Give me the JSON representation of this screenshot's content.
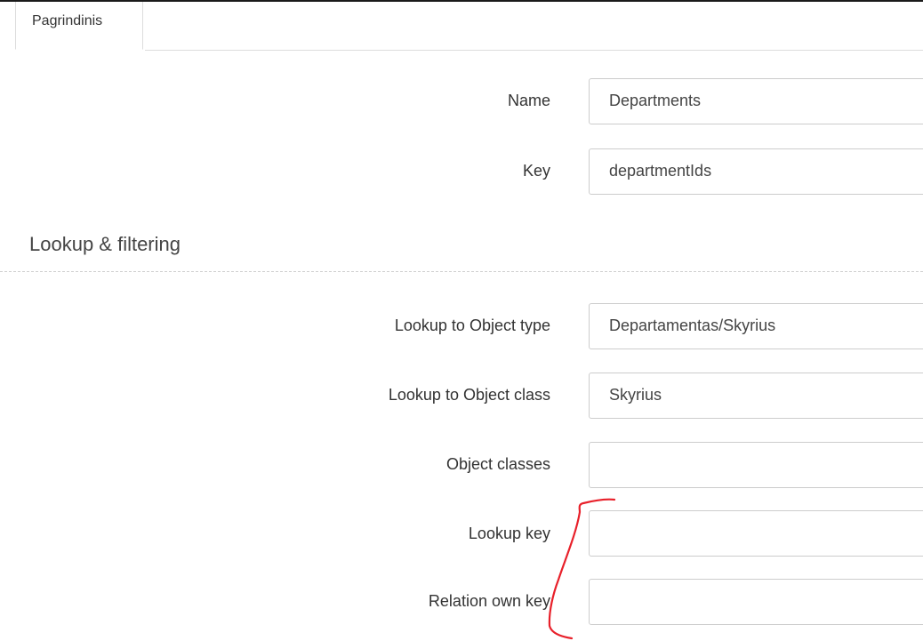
{
  "tabs": {
    "active_label": "Pagrindinis"
  },
  "general": {
    "name_label": "Name",
    "name_value": "Departments",
    "key_label": "Key",
    "key_value": "departmentIds"
  },
  "lookup_section": {
    "title": "Lookup & filtering",
    "object_type_label": "Lookup to Object type",
    "object_type_value": "Departamentas/Skyrius",
    "object_class_label": "Lookup to Object class",
    "object_class_value": "Skyrius",
    "object_classes_label": "Object classes",
    "object_classes_value": "",
    "lookup_key_label": "Lookup key",
    "lookup_key_value": "",
    "relation_own_key_label": "Relation own key",
    "relation_own_key_value": ""
  },
  "annotation": {
    "color": "#e8202a"
  }
}
